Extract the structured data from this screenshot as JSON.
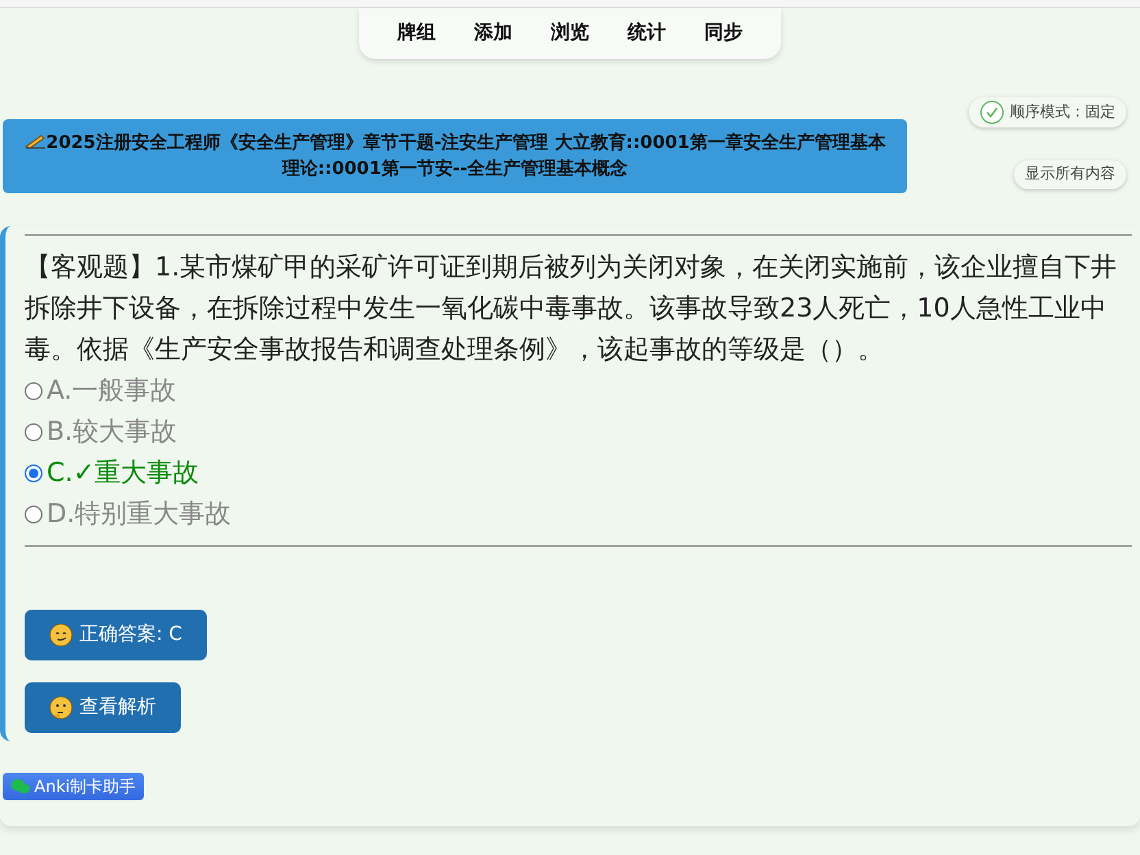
{
  "nav_tabs": [
    {
      "label": "牌组"
    },
    {
      "label": "添加"
    },
    {
      "label": "浏览"
    },
    {
      "label": "统计"
    },
    {
      "label": "同步"
    }
  ],
  "deck_title": "2025注册安全工程师《安全生产管理》章节干题-注安生产管理 大立教育::0001第一章安全生产管理基本理论::0001第一节安--全生产管理基本概念",
  "order_mode": {
    "label": "顺序模式：固定",
    "checked": true
  },
  "show_all_button": "显示所有内容",
  "question": "【客观题】1.某市煤矿甲的采矿许可证到期后被列为关闭对象，在关闭实施前，该企业擅自下井拆除井下设备，在拆除过程中发生一氧化碳中毒事故。该事故导致23人死亡，10人急性工业中毒。依据《生产安全事故报告和调查处理条例》，该起事故的等级是（）。",
  "options": [
    {
      "label": "A.一般事故",
      "selected": false,
      "correct": false
    },
    {
      "label": "B.较大事故",
      "selected": false,
      "correct": false
    },
    {
      "label": "C.✓重大事故",
      "selected": true,
      "correct": true
    },
    {
      "label": "D.特别重大事故",
      "selected": false,
      "correct": false
    }
  ],
  "buttons": [
    {
      "kind": "answer",
      "label": "正确答案: C"
    },
    {
      "kind": "analysis",
      "label": "查看解析"
    }
  ],
  "footer_badge": "Anki制卡助手"
}
